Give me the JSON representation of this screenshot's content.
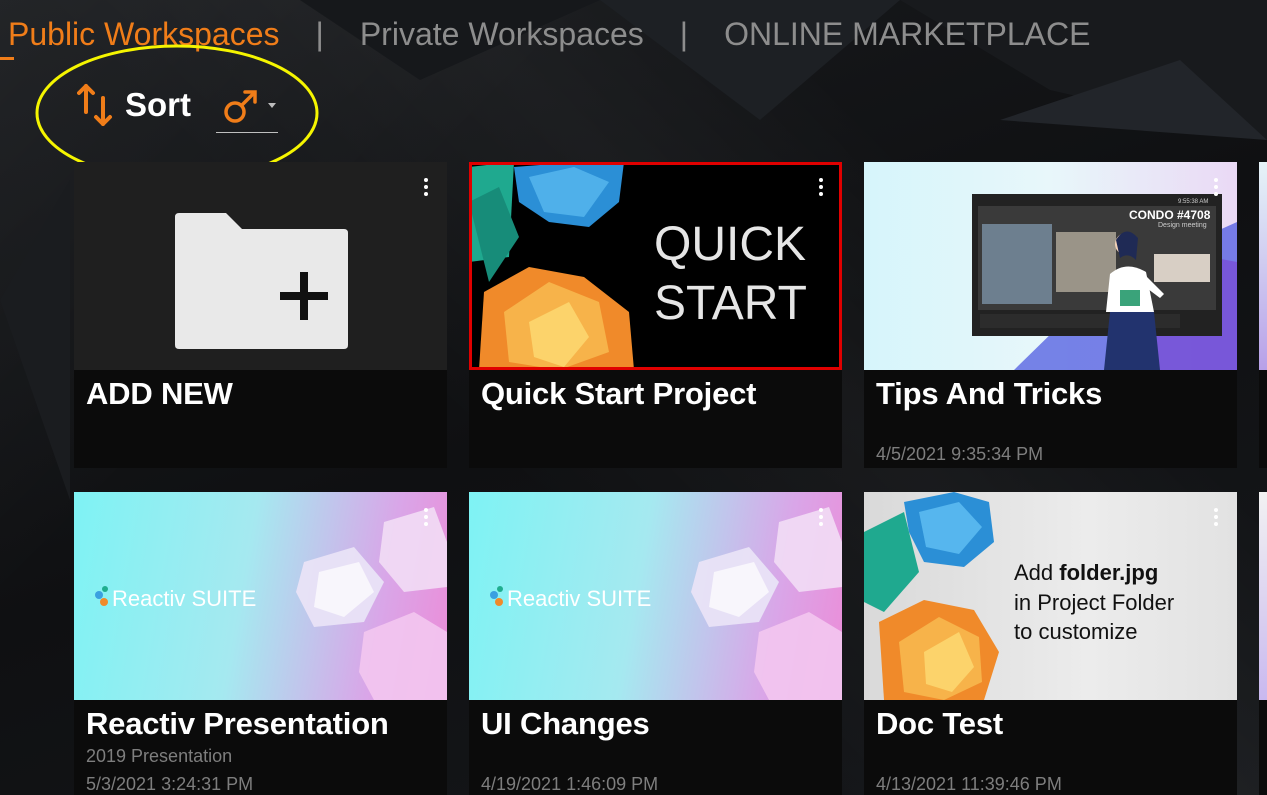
{
  "tabs": [
    {
      "label": "Public Workspaces",
      "active": true
    },
    {
      "label": "Private Workspaces",
      "active": false
    },
    {
      "label": "ONLINE MARKETPLACE",
      "active": false
    }
  ],
  "tab_separator": "|",
  "sort": {
    "label": "Sort",
    "icon": "sort-arrows-icon",
    "selected_icon": "male-symbol-icon"
  },
  "colors": {
    "accent": "#f07d19",
    "highlight_ellipse": "#f5f500",
    "selected_border": "#e00000"
  },
  "cards": [
    {
      "title": "ADD NEW",
      "type": "add",
      "icon": "folder-plus-icon"
    },
    {
      "title": "Quick Start Project",
      "type": "project",
      "thumb_text": [
        "QUICK",
        "START"
      ],
      "selected": true
    },
    {
      "title": "Tips And Tricks",
      "date": "4/5/2021 9:35:34 PM",
      "thumb_text": [
        "CONDO #4708",
        "Design meeting",
        "9:55:38 AM"
      ]
    },
    {
      "title": "Reactiv Presentation",
      "subtitle": "2019 Presentation",
      "date": "5/3/2021 3:24:31 PM",
      "thumb_text": "Reactiv SUITE"
    },
    {
      "title": "UI Changes",
      "date": "4/19/2021 1:46:09 PM",
      "thumb_text": "Reactiv SUITE"
    },
    {
      "title": "Doc Test",
      "date": "4/13/2021 11:39:46 PM",
      "thumb_text": {
        "line1_pre": "Add ",
        "line1_bold": "folder.jpg",
        "line2": "in Project Folder",
        "line3": "to customize"
      }
    }
  ]
}
